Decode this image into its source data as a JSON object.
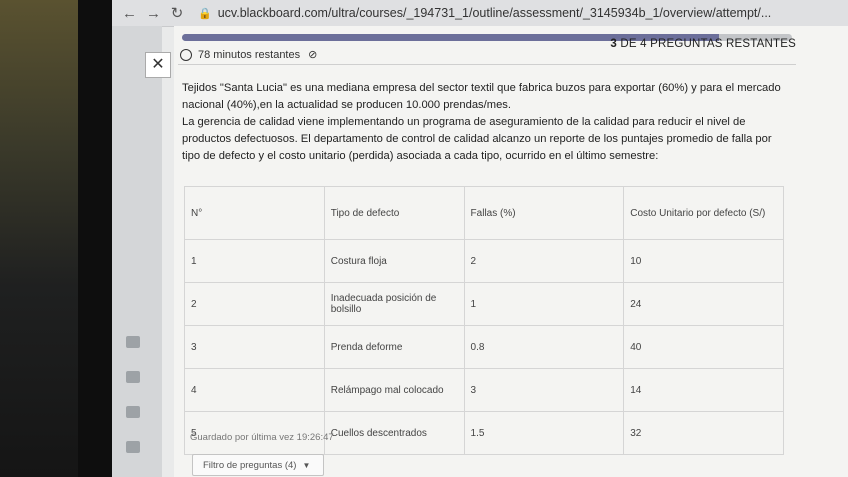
{
  "browser": {
    "url": "ucv.blackboard.com/ultra/courses/_194731_1/outline/assessment/_3145934b_1/overview/attempt/..."
  },
  "assessment": {
    "progress": 0.88,
    "timer_text": "78 minutos restantes",
    "remaining_count": "3",
    "remaining_text": "DE 4 PREGUNTAS RESTANTES",
    "saved_text": "Guardado por última vez 19:26:47",
    "filter_label": "Filtro de preguntas (4)"
  },
  "question": {
    "paragraph1": "Tejidos \"Santa Lucia\" es una mediana empresa del sector textil que fabrica buzos para exportar (60%) y para el mercado nacional (40%),en la actualidad se producen 10.000 prendas/mes.",
    "paragraph2": "La gerencia de calidad viene implementando un programa de aseguramiento de la calidad para reducir el nivel de productos defectuosos. El departamento de control de calidad alcanzo un reporte de los puntajes promedio de falla por tipo de defecto y el costo unitario (perdida) asociada a cada tipo, ocurrido en el último semestre:"
  },
  "table": {
    "headers": [
      "N°",
      "Tipo de defecto",
      "Fallas (%)",
      "Costo Unitario por defecto (S/)"
    ],
    "rows": [
      [
        "1",
        "Costura floja",
        "2",
        "10"
      ],
      [
        "2",
        "Inadecuada posición de bolsillo",
        "1",
        "24"
      ],
      [
        "3",
        "Prenda deforme",
        "0.8",
        "40"
      ],
      [
        "4",
        "Relámpago mal colocado",
        "3",
        "14"
      ],
      [
        "5",
        "Cuellos descentrados",
        "1.5",
        "32"
      ]
    ]
  }
}
